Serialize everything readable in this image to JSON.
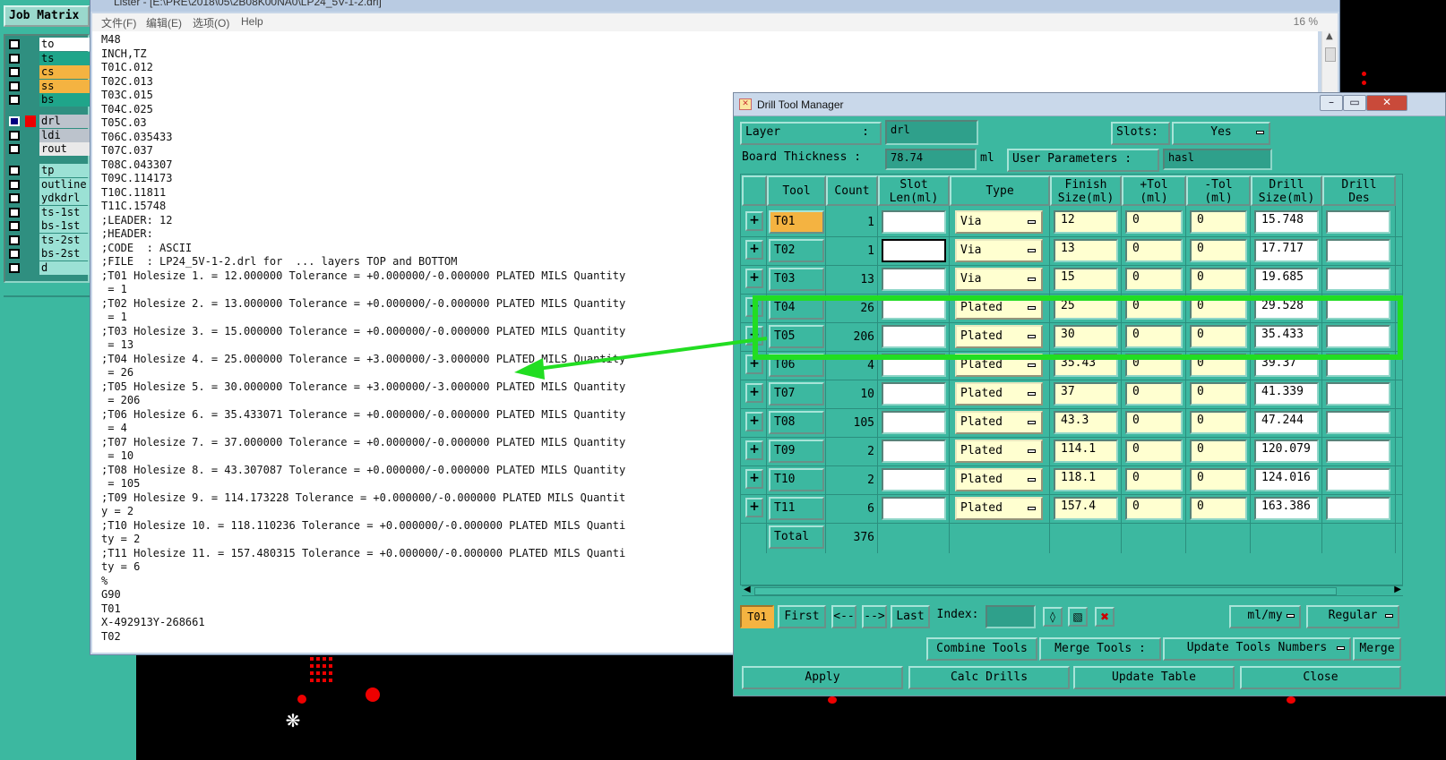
{
  "job_matrix": {
    "title": "Job Matrix",
    "layers": [
      {
        "name": "to",
        "color": "#ffffff",
        "checked": false
      },
      {
        "name": "ts",
        "color": "#1fa58a",
        "checked": false
      },
      {
        "name": "cs",
        "color": "#f4b341",
        "checked": false
      },
      {
        "name": "ss",
        "color": "#f4b341",
        "checked": false
      },
      {
        "name": "bs",
        "color": "#1fa58a",
        "checked": false
      },
      {
        "name": "drl",
        "color": "#bcc3cc",
        "checked": true
      },
      {
        "name": "ldi",
        "color": "#bcc3cc",
        "checked": false
      },
      {
        "name": "rout",
        "color": "#e9e9e9",
        "checked": false
      },
      {
        "name": "tp",
        "color": "#9be1d5",
        "checked": false
      },
      {
        "name": "outline",
        "color": "#9be1d5",
        "checked": false
      },
      {
        "name": "ydkdrl",
        "color": "#9be1d5",
        "checked": false
      },
      {
        "name": "ts-1st",
        "color": "#9be1d5",
        "checked": false
      },
      {
        "name": "bs-1st",
        "color": "#9be1d5",
        "checked": false
      },
      {
        "name": "ts-2st",
        "color": "#9be1d5",
        "checked": false
      },
      {
        "name": "bs-2st",
        "color": "#9be1d5",
        "checked": false
      },
      {
        "name": "d",
        "color": "#9be1d5",
        "checked": false
      }
    ]
  },
  "lister": {
    "title": "Lister - [E:\\PRE\\2018\\05\\2B08K00NA0\\LP24_5V-1-2.drl]",
    "menu": [
      "文件(F)",
      "编辑(E)",
      "选项(O)",
      "Help"
    ],
    "zoom": "16 %",
    "lines": [
      "M48",
      "INCH,TZ",
      "T01C.012",
      "T02C.013",
      "T03C.015",
      "T04C.025",
      "T05C.03",
      "T06C.035433",
      "T07C.037",
      "T08C.043307",
      "T09C.114173",
      "T10C.11811",
      "T11C.15748",
      ";LEADER: 12",
      ";HEADER:",
      ";CODE  : ASCII",
      ";FILE  : LP24_5V-1-2.drl for  ... layers TOP and BOTTOM",
      ";T01 Holesize 1. = 12.000000 Tolerance = +0.000000/-0.000000 PLATED MILS Quantity",
      " = 1",
      ";T02 Holesize 2. = 13.000000 Tolerance = +0.000000/-0.000000 PLATED MILS Quantity",
      " = 1",
      ";T03 Holesize 3. = 15.000000 Tolerance = +0.000000/-0.000000 PLATED MILS Quantity",
      " = 13",
      ";T04 Holesize 4. = 25.000000 Tolerance = +3.000000/-3.000000 PLATED MILS Quantity",
      " = 26",
      ";T05 Holesize 5. = 30.000000 Tolerance = +3.000000/-3.000000 PLATED MILS Quantity",
      " = 206",
      ";T06 Holesize 6. = 35.433071 Tolerance = +0.000000/-0.000000 PLATED MILS Quantity",
      " = 4",
      ";T07 Holesize 7. = 37.000000 Tolerance = +0.000000/-0.000000 PLATED MILS Quantity",
      " = 10",
      ";T08 Holesize 8. = 43.307087 Tolerance = +0.000000/-0.000000 PLATED MILS Quantity",
      " = 105",
      ";T09 Holesize 9. = 114.173228 Tolerance = +0.000000/-0.000000 PLATED MILS Quantit",
      "y = 2",
      ";T10 Holesize 10. = 118.110236 Tolerance = +0.000000/-0.000000 PLATED MILS Quanti",
      "ty = 2",
      ";T11 Holesize 11. = 157.480315 Tolerance = +0.000000/-0.000000 PLATED MILS Quanti",
      "ty = 6",
      "%",
      "G90",
      "T01",
      "X-492913Y-268661",
      "T02"
    ]
  },
  "dtm": {
    "title": "Drill Tool Manager",
    "window_buttons": [
      "–",
      "▭",
      "✕"
    ],
    "layer_label": "Layer",
    "layer_colon": ":",
    "layer_value": "drl",
    "slots_label": "Slots:",
    "slots_value": "Yes",
    "board_thickness_label": "Board Thickness :",
    "board_thickness_value": "78.74",
    "board_thickness_unit": "ml",
    "user_params_label": "User Parameters :",
    "user_params_value": "hasl",
    "columns": [
      "Tool",
      "Count",
      "Slot\nLen(ml)",
      "Type",
      "Finish\nSize(ml)",
      "+Tol\n(ml)",
      "-Tol\n(ml)",
      "Drill\nSize(ml)",
      "Drill\nDes"
    ],
    "rows": [
      {
        "tool": "T01",
        "count": "1",
        "type": "Via",
        "finish": "12",
        "ptol": "0",
        "mtol": "0",
        "drill": "15.748"
      },
      {
        "tool": "T02",
        "count": "1",
        "type": "Via",
        "finish": "13",
        "ptol": "0",
        "mtol": "0",
        "drill": "17.717"
      },
      {
        "tool": "T03",
        "count": "13",
        "type": "Via",
        "finish": "15",
        "ptol": "0",
        "mtol": "0",
        "drill": "19.685"
      },
      {
        "tool": "T04",
        "count": "26",
        "type": "Plated",
        "finish": "25",
        "ptol": "0",
        "mtol": "0",
        "drill": "29.528"
      },
      {
        "tool": "T05",
        "count": "206",
        "type": "Plated",
        "finish": "30",
        "ptol": "0",
        "mtol": "0",
        "drill": "35.433"
      },
      {
        "tool": "T06",
        "count": "4",
        "type": "Plated",
        "finish": "35.43",
        "ptol": "0",
        "mtol": "0",
        "drill": "39.37"
      },
      {
        "tool": "T07",
        "count": "10",
        "type": "Plated",
        "finish": "37",
        "ptol": "0",
        "mtol": "0",
        "drill": "41.339"
      },
      {
        "tool": "T08",
        "count": "105",
        "type": "Plated",
        "finish": "43.3",
        "ptol": "0",
        "mtol": "0",
        "drill": "47.244"
      },
      {
        "tool": "T09",
        "count": "2",
        "type": "Plated",
        "finish": "114.1",
        "ptol": "0",
        "mtol": "0",
        "drill": "120.079"
      },
      {
        "tool": "T10",
        "count": "2",
        "type": "Plated",
        "finish": "118.1",
        "ptol": "0",
        "mtol": "0",
        "drill": "124.016"
      },
      {
        "tool": "T11",
        "count": "6",
        "type": "Plated",
        "finish": "157.4",
        "ptol": "0",
        "mtol": "0",
        "drill": "163.386"
      }
    ],
    "total_label": "Total",
    "total_count": "376",
    "nav": {
      "current_tool": "T01",
      "first": "First",
      "prev": "<--",
      "next": "-->",
      "last": "Last",
      "index_label": "Index:",
      "units": "ml/my",
      "mode": "Regular"
    },
    "actions": {
      "combine": "Combine Tools",
      "merge_label": "Merge Tools :",
      "update_numbers": "Update Tools Numbers",
      "merge": "Merge"
    },
    "bottom": {
      "apply": "Apply",
      "calc": "Calc Drills",
      "update": "Update Table",
      "close": "Close"
    }
  },
  "colors": {
    "panel": "#3cb8a0",
    "selected_tool": "#f4b341",
    "highlight": "#22dd22",
    "board_pad": "#e00000"
  }
}
